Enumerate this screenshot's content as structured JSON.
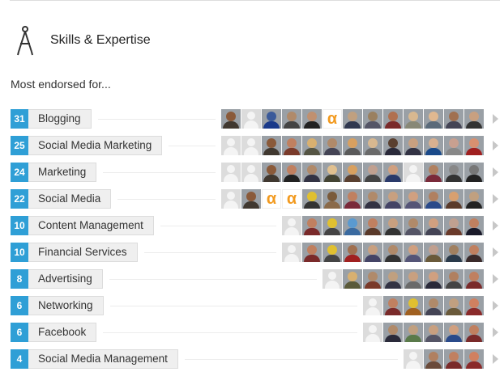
{
  "section": {
    "title": "Skills & Expertise",
    "icon": "compass-icon"
  },
  "subheading": "Most endorsed for...",
  "colors": {
    "count_badge": "#2f9fd6",
    "skill_pill": "#efefef",
    "arrow": "#c7c7c7"
  },
  "skills": [
    {
      "count": "31",
      "name": "Blogging",
      "avatars": [
        "p:#8a5a3a:#403830",
        "b",
        "p:#3a5a9a:#1a3a8a",
        "p:#b08a6a:#444",
        "p:#c09070:#222",
        "l",
        "p:#c0a080:#303850",
        "p:#9a8060:#556",
        "p:#b07050:#7a2a2a",
        "p:#d8b890:#887",
        "p:#e0b890:#5a6a7a",
        "p:#a07050:#445",
        "p:#c8a080:#333"
      ]
    },
    {
      "count": "25",
      "name": "Social Media Marketing",
      "avatars": [
        "b",
        "b",
        "p:#8a5a3a:#403830",
        "p:#c08060:#7a3a2a",
        "p:#d8b070:#554",
        "p:#b08a6a:#445",
        "p:#d8a060:#5a5a5a",
        "p:#d8b890:#6a6a6a",
        "p:#5a4030:#2a2a3a",
        "p:#c8a080:#334",
        "p:#d8b090:#1a4a8a",
        "p:#c8a090:#888",
        "p:#d89070:#a02020"
      ]
    },
    {
      "count": "24",
      "name": "Marketing",
      "avatars": [
        "b",
        "b",
        "p:#8a5a3a:#403830",
        "p:#c08060:#222",
        "p:#b08a6a:#334",
        "p:#e0c090:#443",
        "p:#d8a060:#5a4030",
        "p:#c0a090:#444",
        "p:#d0a080:#2a3a6a",
        "b",
        "p:#b08060:#7a2a3a",
        "p:#888888:#333",
        "p:#777777:#222"
      ]
    },
    {
      "count": "22",
      "name": "Social Media",
      "avatars": [
        "b",
        "p:#8a5a3a:#403830",
        "l",
        "l",
        "p:#e0c030:#333",
        "p:#7a5a3a:#8a6a4a",
        "p:#c08060:#7a2a3a",
        "p:#b08a6a:#334",
        "p:#c8a080:#446",
        "p:#d0a080:#557",
        "p:#b08060:#2a4a8a",
        "p:#d8a070:#5a3a2a",
        "p:#c0a080:#222"
      ]
    },
    {
      "count": "10",
      "name": "Content Management",
      "avatars": [
        "b",
        "p:#c08060:#7a2a2a",
        "p:#e0c030:#444",
        "p:#5a9ad0:#3a6aa0",
        "p:#c08060:#5a3a2a",
        "p:#c8a080:#333",
        "p:#b08a6a:#556",
        "p:#d0a080:#445",
        "p:#c0a090:#6a3a2a",
        "p:#c08060:#1a1a2a"
      ]
    },
    {
      "count": "10",
      "name": "Financial Services",
      "avatars": [
        "b",
        "p:#c08060:#7a2a2a",
        "p:#e0c030:#444",
        "p:#a07050:#a02020",
        "p:#c8a080:#446",
        "p:#b08a6a:#333",
        "p:#d0a080:#557",
        "p:#c0a090:#6a5a3a",
        "p:#a08060:#2a3a4a",
        "p:#c08060:#3a2a2a"
      ]
    },
    {
      "count": "8",
      "name": "Advertising",
      "avatars": [
        "b",
        "p:#d8b070:#5a5a3a",
        "p:#b08a6a:#7a3a2a",
        "p:#c0a080:#334",
        "p:#c8a080:#6a6a6a",
        "p:#d0a080:#2a2a3a",
        "p:#b08060:#444",
        "p:#c08060:#7a2a2a"
      ]
    },
    {
      "count": "6",
      "name": "Networking",
      "avatars": [
        "b",
        "p:#c08060:#7a2a2a",
        "p:#e0c030:#a06020",
        "p:#b08a6a:#445",
        "p:#c0a080:#6a5a3a",
        "p:#d08060:#8a2a2a"
      ]
    },
    {
      "count": "6",
      "name": "Facebook",
      "avatars": [
        "b",
        "p:#b08a6a:#2a2a3a",
        "p:#c0a080:#5a7a4a",
        "p:#c8a080:#556",
        "p:#d0a080:#2a4a8a",
        "p:#c08060:#7a2a2a"
      ]
    },
    {
      "count": "4",
      "name": "Social Media Management",
      "avatars": [
        "b",
        "p:#b08060:#6a4a3a",
        "p:#c08060:#7a2a2a",
        "p:#d08060:#8a2a2a"
      ]
    }
  ]
}
